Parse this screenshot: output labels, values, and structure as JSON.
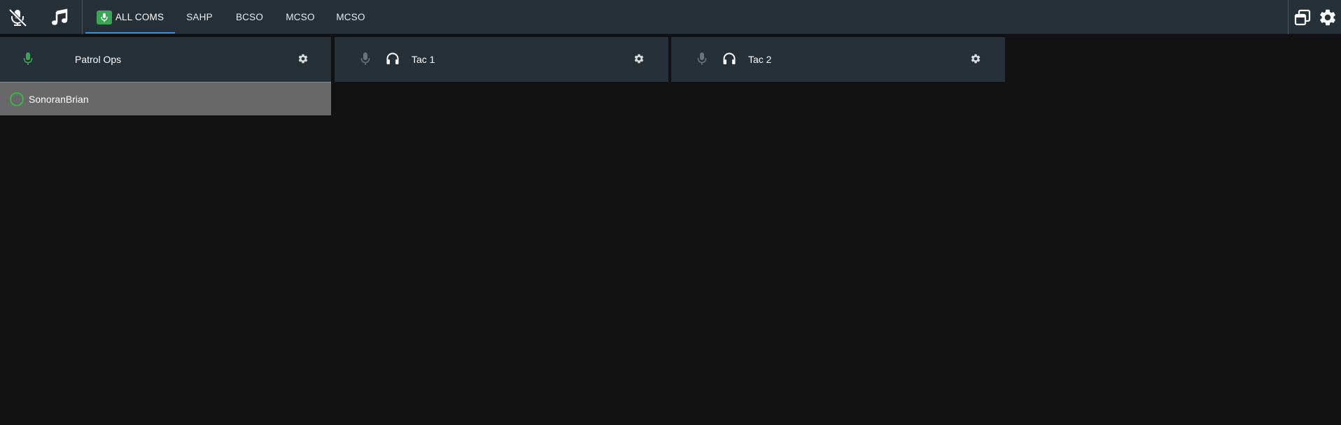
{
  "toolbar": {
    "mute_icon": "microphone-muted-icon",
    "music_icon": "music-note-icon",
    "popout_icon": "popout-window-icon",
    "settings_icon": "gear-icon"
  },
  "tabs": [
    {
      "label": "ALL COMS",
      "active": true,
      "icon": "microphone-icon"
    },
    {
      "label": "SAHP",
      "active": false
    },
    {
      "label": "BCSO",
      "active": false
    },
    {
      "label": "MCSO",
      "active": false
    },
    {
      "label": "MCSO",
      "active": false
    }
  ],
  "channels": [
    {
      "name": "Patrol Ops",
      "mic_active": true,
      "users": [
        "SonoranBrian"
      ]
    },
    {
      "name": "Tac 1",
      "mic_active": false,
      "headphones": true
    },
    {
      "name": "Tac 2",
      "mic_active": false,
      "headphones": true
    }
  ],
  "colors": {
    "accent_green": "#3aa655",
    "tab_underline": "#3c8fd6",
    "header_bg": "#263038",
    "body_bg": "#121212",
    "user_row_bg": "#686868"
  }
}
